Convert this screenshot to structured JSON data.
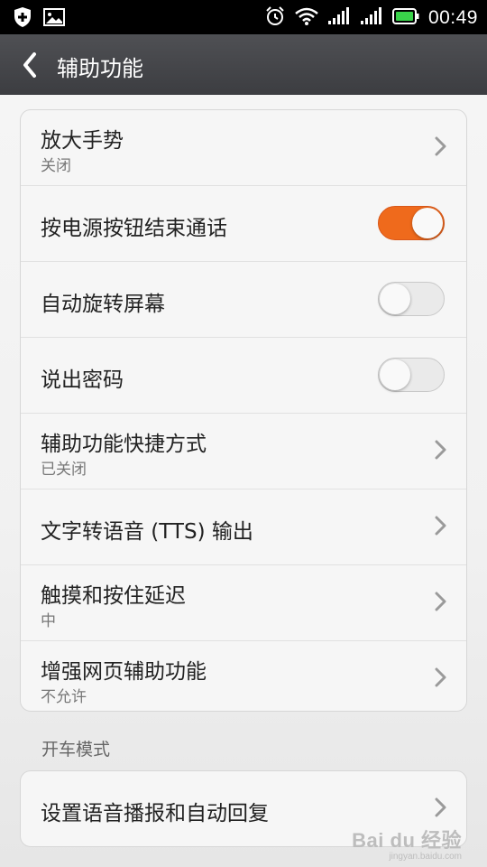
{
  "status_bar": {
    "time": "00:49",
    "icons": [
      "shield-icon",
      "image-icon",
      "alarm-icon",
      "wifi-icon",
      "signal-icon",
      "signal-icon",
      "battery-icon"
    ]
  },
  "title_bar": {
    "title": "辅助功能"
  },
  "main_group": {
    "items": [
      {
        "label": "放大手势",
        "sub": "关闭",
        "type": "link"
      },
      {
        "label": "按电源按钮结束通话",
        "type": "toggle",
        "on": true
      },
      {
        "label": "自动旋转屏幕",
        "type": "toggle",
        "on": false
      },
      {
        "label": "说出密码",
        "type": "toggle",
        "on": false
      },
      {
        "label": "辅助功能快捷方式",
        "sub": "已关闭",
        "type": "link"
      },
      {
        "label": "文字转语音 (TTS) 输出",
        "type": "link"
      },
      {
        "label": "触摸和按住延迟",
        "sub": "中",
        "type": "link"
      },
      {
        "label": "增强网页辅助功能",
        "sub": "不允许",
        "type": "link"
      }
    ]
  },
  "driving_section": {
    "header": "开车模式",
    "items": [
      {
        "label": "设置语音播报和自动回复",
        "type": "link"
      }
    ]
  },
  "watermark": {
    "main": "Bai du 经验",
    "sub": "jingyan.baidu.com"
  },
  "colors": {
    "accent": "#ef6a1c",
    "title_bar": "#45464a",
    "status_bar": "#000000"
  }
}
